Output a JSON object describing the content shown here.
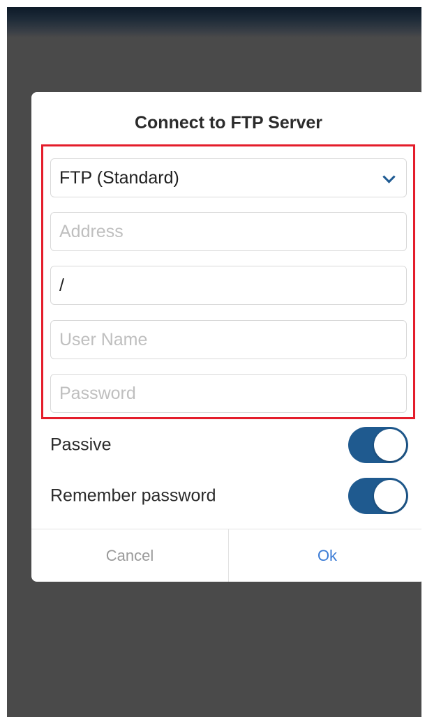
{
  "dialog": {
    "title": "Connect to FTP Server",
    "protocol_select": {
      "value": "FTP (Standard)"
    },
    "fields": {
      "address_placeholder": "Address",
      "path_value": "/",
      "username_placeholder": "User Name",
      "password_placeholder": "Password"
    },
    "toggles": [
      {
        "label": "Passive",
        "on": true
      },
      {
        "label": "Remember password",
        "on": true
      }
    ],
    "buttons": {
      "cancel_label": "Cancel",
      "ok_label": "Ok"
    }
  },
  "colors": {
    "backdrop": "#4a4a4a",
    "highlight_border": "#e41d2b",
    "toggle_on": "#1f5a8f",
    "ok_text": "#3a7bd5",
    "cancel_text": "#9a9a9a"
  },
  "icons": {
    "select_caret": "chevron-down-icon"
  }
}
